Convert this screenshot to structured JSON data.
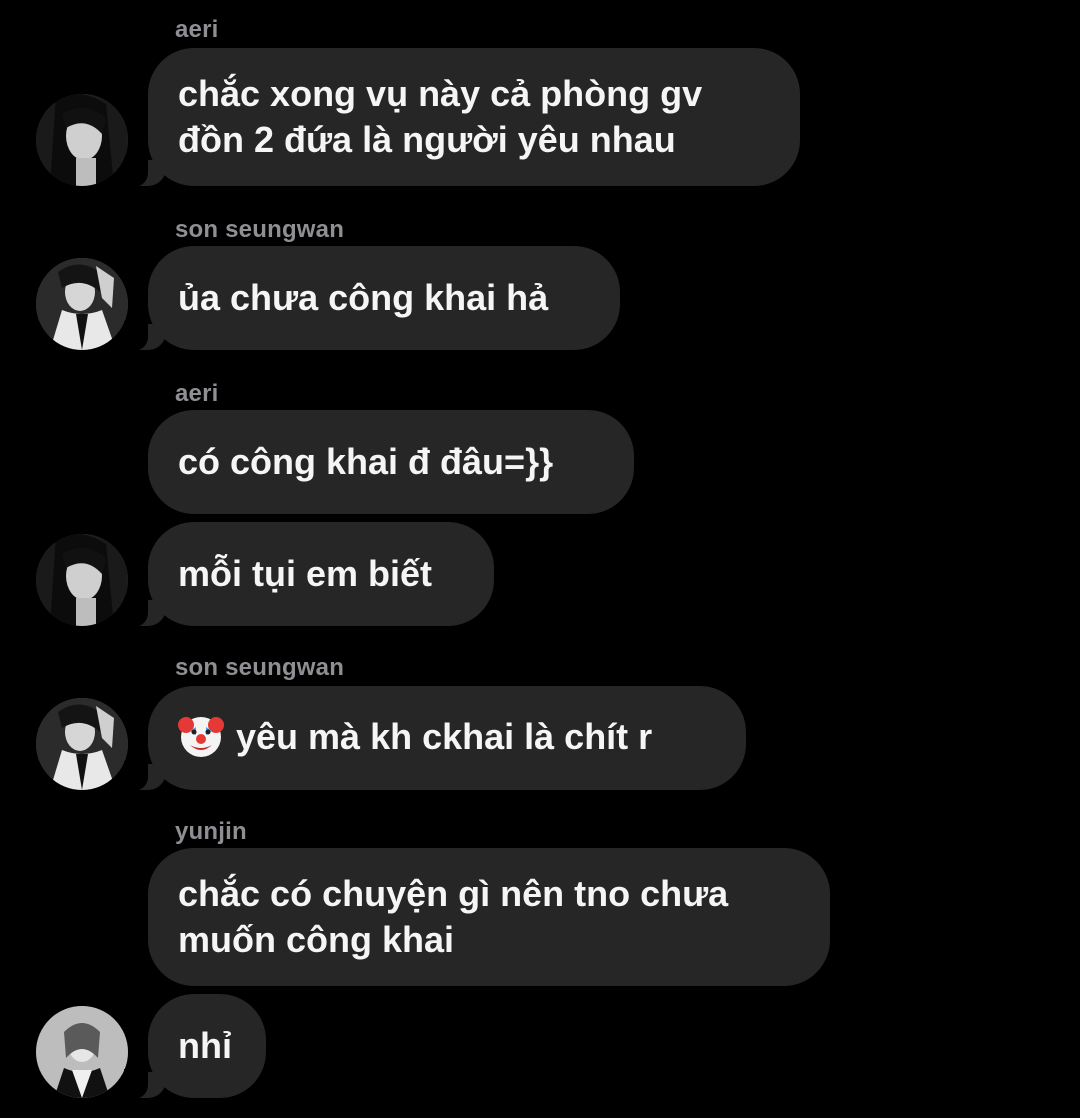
{
  "messages": [
    {
      "sender": "aeri",
      "lines": [
        "chắc xong vụ này cả phòng gv",
        "đồn 2 đứa là người yêu nhau"
      ]
    },
    {
      "sender": "son seungwan",
      "lines": [
        "ủa chưa công khai hả"
      ]
    },
    {
      "sender": "aeri",
      "lines": [
        "có công khai đ đâu=}}"
      ]
    },
    {
      "sender": "",
      "lines": [
        "mỗi tụi em biết"
      ]
    },
    {
      "sender": "son seungwan",
      "emoji": "clown-face",
      "lines": [
        "yêu mà kh ckhai là chít r"
      ]
    },
    {
      "sender": "yunjin",
      "lines": [
        "chắc có chuyện gì nên tno chưa",
        "muốn công khai"
      ]
    },
    {
      "sender": "",
      "lines": [
        "nhỉ"
      ]
    }
  ],
  "colors": {
    "background": "#000000",
    "bubble": "#262626",
    "sender": "#8e8e93",
    "text": "#f5f5f5"
  }
}
